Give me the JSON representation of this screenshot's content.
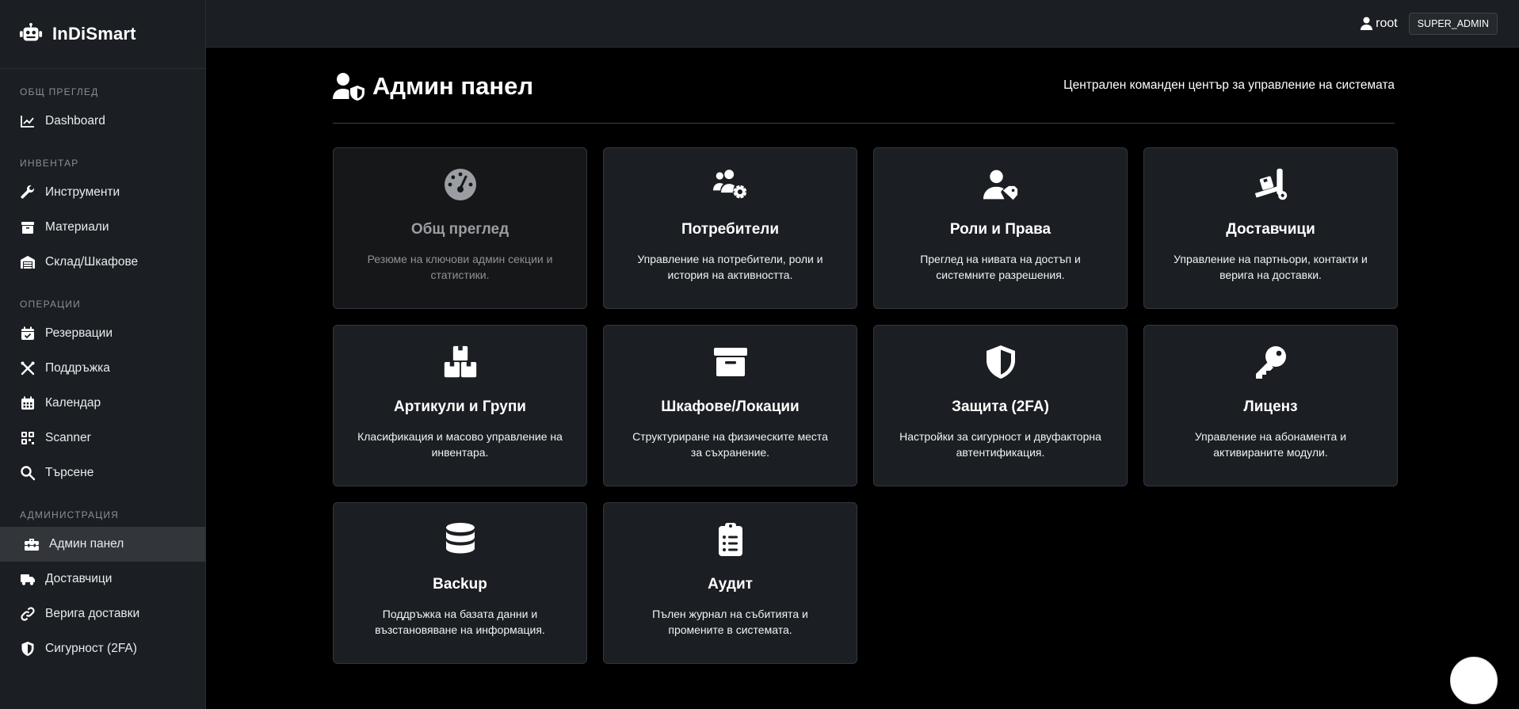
{
  "brand": {
    "name": "InDiSmart",
    "icon": "robot-icon"
  },
  "header": {
    "user": "root",
    "role": "SUPER_ADMIN"
  },
  "sidebar": {
    "sections": [
      {
        "title": "ОБЩ ПРЕГЛЕД",
        "items": [
          {
            "label": "Dashboard",
            "icon": "chart-line-icon"
          }
        ]
      },
      {
        "title": "ИНВЕНТАР",
        "items": [
          {
            "label": "Инструменти",
            "icon": "wrench-icon"
          },
          {
            "label": "Материали",
            "icon": "box-icon"
          },
          {
            "label": "Склад/Шкафове",
            "icon": "warehouse-icon"
          }
        ]
      },
      {
        "title": "ОПЕРАЦИИ",
        "items": [
          {
            "label": "Резервации",
            "icon": "calendar-check-icon"
          },
          {
            "label": "Поддръжка",
            "icon": "tools-icon"
          },
          {
            "label": "Календар",
            "icon": "calendar-icon"
          },
          {
            "label": "Scanner",
            "icon": "qrcode-icon"
          },
          {
            "label": "Търсене",
            "icon": "search-icon"
          }
        ]
      },
      {
        "title": "АДМИНИСТРАЦИЯ",
        "items": [
          {
            "label": "Админ панел",
            "icon": "toolbox-icon",
            "active": true
          },
          {
            "label": "Доставчици",
            "icon": "truck-icon"
          },
          {
            "label": "Верига доставки",
            "icon": "link-icon"
          },
          {
            "label": "Сигурност (2FA)",
            "icon": "shield-icon"
          }
        ]
      }
    ]
  },
  "page": {
    "title": "Админ панел",
    "subtitle": "Централен команден център за управление на системата",
    "icon": "user-shield-icon"
  },
  "cards": [
    {
      "title": "Общ преглед",
      "desc": "Резюме на ключови админ секции и статистики.",
      "icon": "gauge-icon",
      "muted": true
    },
    {
      "title": "Потребители",
      "desc": "Управление на потребители, роли и история на активността.",
      "icon": "users-cog-icon"
    },
    {
      "title": "Роли и Права",
      "desc": "Преглед на нивата на достъп и системните разрешения.",
      "icon": "user-tag-icon"
    },
    {
      "title": "Доставчици",
      "desc": "Управление на партньори, контакти и верига на доставки.",
      "icon": "dolly-icon"
    },
    {
      "title": "Артикули и Групи",
      "desc": "Класификация и масово управление на инвентара.",
      "icon": "boxes-icon"
    },
    {
      "title": "Шкафове/Локации",
      "desc": "Структуриране на физическите места за съхранение.",
      "icon": "archive-icon"
    },
    {
      "title": "Защита (2FA)",
      "desc": "Настройки за сигурност и двуфакторна автентификация.",
      "icon": "shield-halved-icon"
    },
    {
      "title": "Лиценз",
      "desc": "Управление на абонамента и активираните модули.",
      "icon": "key-icon"
    },
    {
      "title": "Backup",
      "desc": "Поддръжка на базата данни и възстановяване на информация.",
      "icon": "database-icon"
    },
    {
      "title": "Аудит",
      "desc": "Пълен журнал на събитията и промените в системата.",
      "icon": "clipboard-list-icon"
    }
  ],
  "colors": {
    "background": "#000000",
    "panel": "#1b1e22",
    "border": "#33383e",
    "active": "#32363b",
    "muted_text": "#8a9097"
  }
}
